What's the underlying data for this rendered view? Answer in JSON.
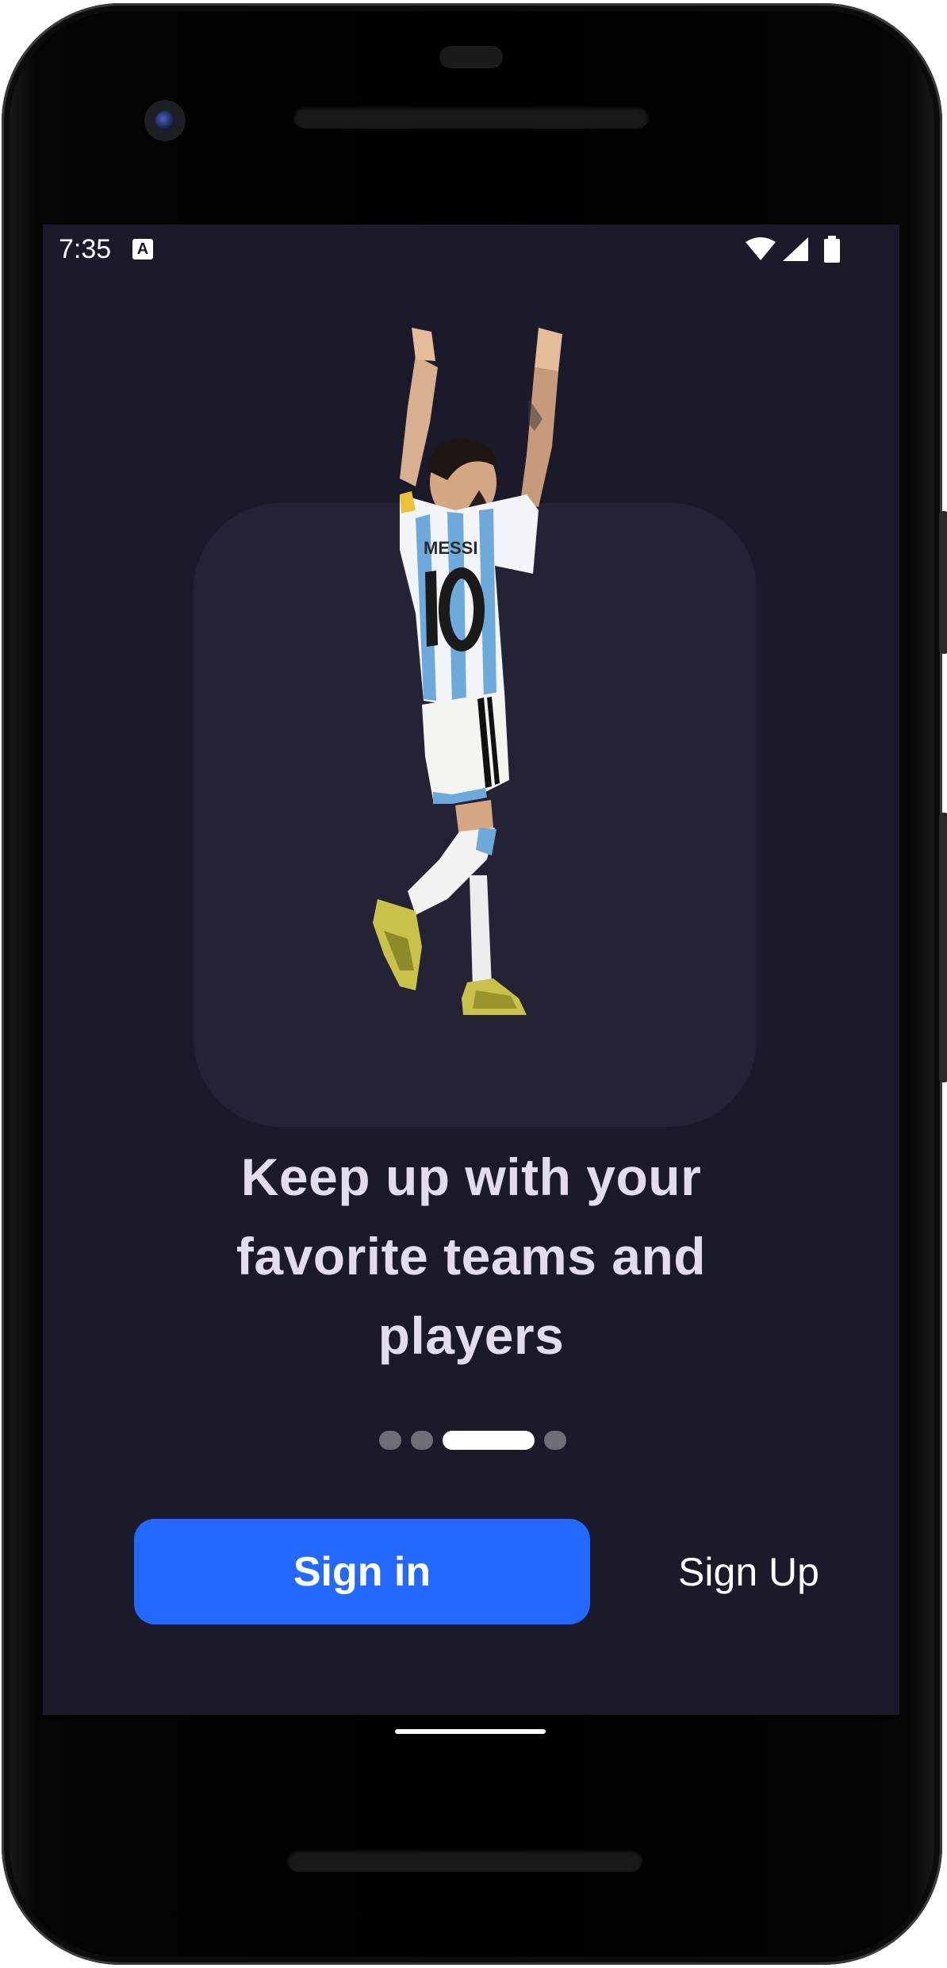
{
  "status_bar": {
    "time": "7:35",
    "notification_icon": "a-icon",
    "icons": [
      "wifi-icon",
      "signal-icon",
      "battery-icon"
    ]
  },
  "hero": {
    "image": "player-celebration-illustration",
    "jersey_text": "MESSI"
  },
  "onboarding": {
    "headline_line1": "Keep up with your",
    "headline_line2": "favorite teams and",
    "headline_line3": "players",
    "pages_total": 4,
    "current_page": 3
  },
  "actions": {
    "sign_in_label": "Sign in",
    "sign_up_label": "Sign Up"
  },
  "colors": {
    "background": "#1b1a2b",
    "card": "#242336",
    "accent": "#2469ff",
    "headline": "#e2dcec"
  }
}
